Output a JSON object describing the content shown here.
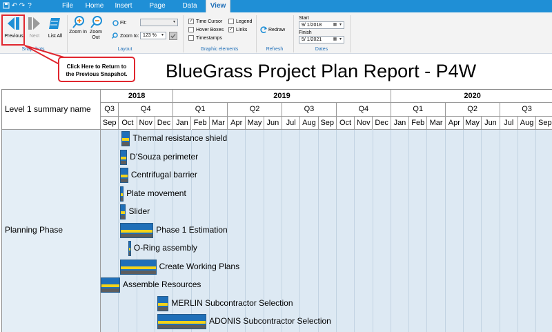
{
  "menu": {
    "tabs": [
      "File",
      "Home",
      "Insert",
      "Page Layout",
      "Data",
      "View"
    ],
    "active": "View"
  },
  "ribbon": {
    "snapshots": {
      "label": "Snapshots",
      "previous": "Previous",
      "next": "Next",
      "list_all": "List All"
    },
    "layout": {
      "label": "Layout",
      "zoom_in": "Zoom In",
      "zoom_out": "Zoom Out",
      "fit_label": "Fit:",
      "fit_value": "",
      "zoom_to_label": "Zoom to:",
      "zoom_to_value": "123 %"
    },
    "graphic": {
      "label": "Graphic elements",
      "time_cursor": "Time Cursor",
      "time_cursor_checked": true,
      "hover_boxes": "Hover Boxes",
      "hover_boxes_checked": false,
      "timestamps": "Timestamps",
      "timestamps_checked": false,
      "legend": "Legend",
      "legend_checked": false,
      "links": "Links",
      "links_checked": true
    },
    "refresh": {
      "label": "Refresh",
      "redraw": "Redraw"
    },
    "dates": {
      "label": "Dates",
      "start_label": "Start",
      "start_value": "9/  1/2018",
      "finish_label": "Finish",
      "finish_value": "5/  1/2021"
    }
  },
  "callout": {
    "line1": "Click Here to Return to",
    "line2": "the Previous Snapshot."
  },
  "report": {
    "title": "BlueGrass Project Plan Report - P4W"
  },
  "grid": {
    "header_label": "Level 1 summary name",
    "years": [
      "2018",
      "2019",
      "2020"
    ],
    "quarters": [
      "Q3",
      "Q4",
      "Q1",
      "Q2",
      "Q3",
      "Q4",
      "Q1",
      "Q2",
      "Q3"
    ],
    "months": [
      "Sep",
      "Oct",
      "Nov",
      "Dec",
      "Jan",
      "Feb",
      "Mar",
      "Apr",
      "May",
      "Jun",
      "Jul",
      "Aug",
      "Sep",
      "Oct",
      "Nov",
      "Dec",
      "Jan",
      "Feb",
      "Mar",
      "Apr",
      "May",
      "Jun",
      "Jul",
      "Aug",
      "Sep"
    ],
    "group_name": "Planning Phase",
    "tasks": [
      {
        "name": "Thermal resistance shield",
        "start": "2018-10-05",
        "end": "2018-10-20"
      },
      {
        "name": "D'Souza perimeter",
        "start": "2018-10-03",
        "end": "2018-10-15"
      },
      {
        "name": "Centrifugal barrier",
        "start": "2018-10-03",
        "end": "2018-10-17"
      },
      {
        "name": "Plate movement",
        "start": "2018-10-03",
        "end": "2018-10-09"
      },
      {
        "name": "Slider",
        "start": "2018-10-03",
        "end": "2018-10-13"
      },
      {
        "name": "Phase 1 Estimation",
        "start": "2018-10-03",
        "end": "2018-11-28"
      },
      {
        "name": "O-Ring assembly",
        "start": "2018-10-17",
        "end": "2018-10-20"
      },
      {
        "name": "Create Working Plans",
        "start": "2018-10-03",
        "end": "2018-12-03"
      },
      {
        "name": "Assemble Resources",
        "start": "2018-09-01",
        "end": "2018-10-03"
      },
      {
        "name": "MERLIN Subcontractor Selection",
        "start": "2018-12-05",
        "end": "2018-12-24"
      },
      {
        "name": "ADONIS Subcontractor Selection",
        "start": "2018-12-05",
        "end": "2019-02-24"
      }
    ]
  },
  "colors": {
    "accent": "#1f8fd6",
    "bar_fill": "#1f6fb8",
    "bar_stripe": "#f3d31a",
    "highlight": "#e0262e",
    "grid_body": "#dde9f3"
  }
}
